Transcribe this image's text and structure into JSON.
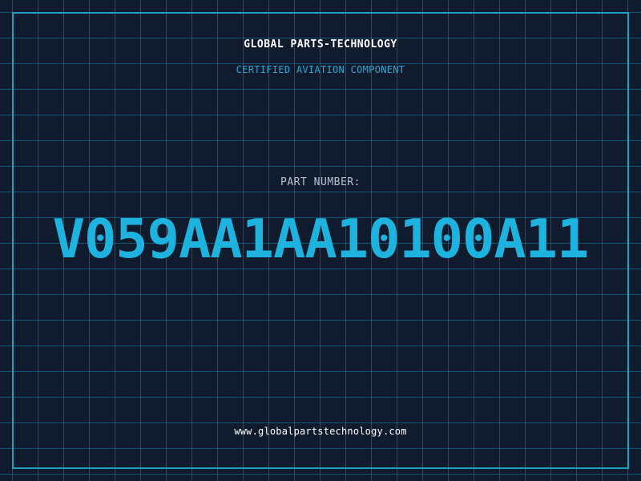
{
  "header": {
    "company": "GLOBAL PARTS-TECHNOLOGY",
    "subtitle": "CERTIFIED AVIATION COMPONENT"
  },
  "part": {
    "label": "PART NUMBER:",
    "number": "V059AA1AA10100A11"
  },
  "footer": {
    "website": "www.globalpartstechnology.com"
  },
  "colors": {
    "background": "#111b2e",
    "grid": "#1482aa",
    "accent": "#1eb3de",
    "label": "#b8c2cf",
    "text": "#ffffff"
  }
}
